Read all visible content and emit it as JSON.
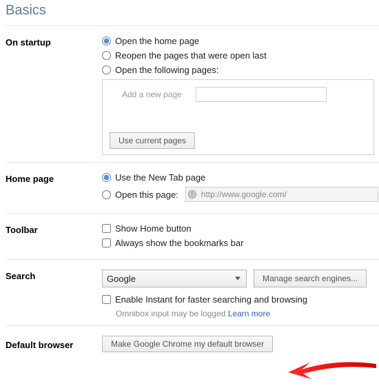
{
  "title": "Basics",
  "startup": {
    "label": "On startup",
    "options": {
      "home": "Open the home page",
      "reopen": "Reopen the pages that were open last",
      "following": "Open the following pages:"
    },
    "add_page_placeholder": "Add a new page",
    "use_current_btn": "Use current pages"
  },
  "homepage": {
    "label": "Home page",
    "use_newtab": "Use the New Tab page",
    "open_this": "Open this page:",
    "url_value": "http://www.google.com/"
  },
  "toolbar": {
    "label": "Toolbar",
    "show_home": "Show Home button",
    "show_bookmarks": "Always show the bookmarks bar"
  },
  "search": {
    "label": "Search",
    "engine": "Google",
    "manage_btn": "Manage search engines...",
    "instant_label": "Enable Instant for faster searching and browsing",
    "instant_note_prefix": "Omnibox input may be logged ",
    "instant_learn_more": "Learn more"
  },
  "default_browser": {
    "label": "Default browser",
    "make_default_btn": "Make Google Chrome my default browser"
  }
}
